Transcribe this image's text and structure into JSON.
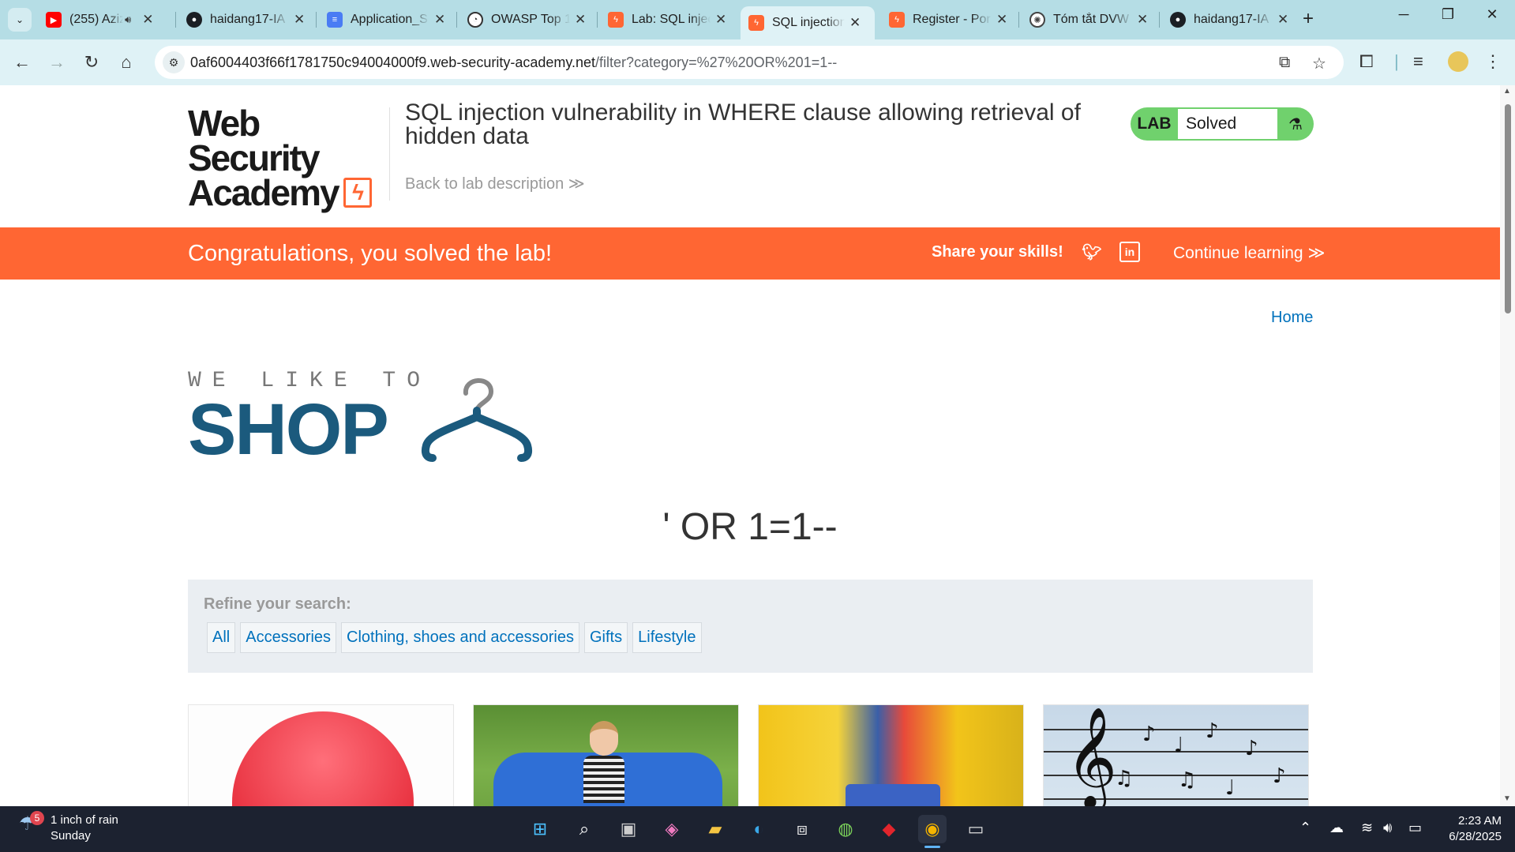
{
  "browser": {
    "tabs": [
      {
        "label": "(255) Aziz",
        "favicon": "youtube-icon",
        "color": "#ff0000",
        "close": "✕",
        "audio": true
      },
      {
        "label": "haidang17-IA",
        "favicon": "github-icon",
        "color": "#1b1f24",
        "close": "✕"
      },
      {
        "label": "Application_S",
        "favicon": "docs-icon",
        "color": "#4a7cf4",
        "close": "✕"
      },
      {
        "label": "OWASP Top 1",
        "favicon": "owasp-icon",
        "color": "#333333",
        "close": "✕"
      },
      {
        "label": "Lab: SQL injec",
        "favicon": "portswigger-icon",
        "color": "#ff6633",
        "close": "✕"
      },
      {
        "label": "SQL injection",
        "favicon": "portswigger-icon",
        "color": "#ff6633",
        "close": "✕",
        "active": true
      },
      {
        "label": "Register - Por",
        "favicon": "portswigger-icon",
        "color": "#ff6633",
        "close": "✕"
      },
      {
        "label": "Tóm tắt DVW",
        "favicon": "openai-icon",
        "color": "#444444",
        "close": "✕"
      },
      {
        "label": "haidang17-IA",
        "favicon": "github-icon",
        "color": "#1b1f24",
        "close": "✕"
      }
    ],
    "new_tab": "+",
    "url_host": "0af6004403f66f1781750c94004000f9.web-security-academy.net",
    "url_path": "/filter?category=%27%20OR%201=1--"
  },
  "lab_header": {
    "logo_line1": "Web Security",
    "logo_line2": "Academy",
    "title": "SQL injection vulnerability in WHERE clause allowing retrieval of hidden data",
    "back_link": "Back to lab description ≫",
    "badge_lab": "LAB",
    "badge_status": "Solved",
    "badge_color": "#70d16d"
  },
  "banner": {
    "message": "Congratulations, you solved the lab!",
    "share": "Share your skills!",
    "continue": "Continue learning ≫",
    "color": "#ff6633"
  },
  "nav": {
    "home": "Home"
  },
  "shop_logo": {
    "tagline": "WE LIKE TO",
    "word": "SHOP"
  },
  "heading": "' OR 1=1--",
  "filter": {
    "label": "Refine your search:",
    "options": [
      "All",
      "Accessories",
      "Clothing, shoes and accessories",
      "Gifts",
      "Lifestyle"
    ]
  },
  "products": [
    {
      "image": "red-umbrella"
    },
    {
      "image": "girl-on-bean-bag"
    },
    {
      "image": "bouncy-castle"
    },
    {
      "image": "music-notes-on-wires"
    }
  ],
  "taskbar": {
    "weather_badge": "5",
    "weather_line1": "1 inch of rain",
    "weather_line2": "Sunday",
    "time": "2:23 AM",
    "date": "6/28/2025"
  }
}
